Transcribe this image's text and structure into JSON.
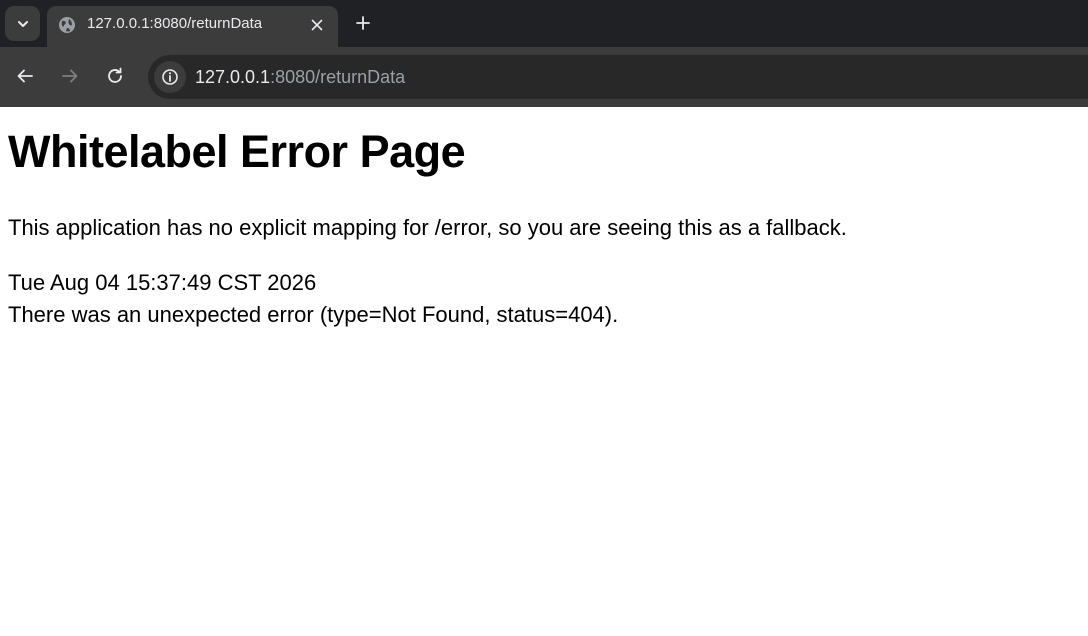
{
  "browser": {
    "tab": {
      "title": "127.0.0.1:8080/returnData"
    },
    "address_bar": {
      "host": "127.0.0.1",
      "path": ":8080/returnData"
    },
    "colors": {
      "tabstrip_bg": "#202124",
      "toolbar_bg": "#3c3c3c",
      "omnibox_bg": "#282828"
    }
  },
  "page": {
    "title": "Whitelabel Error Page",
    "message": "This application has no explicit mapping for /error, so you are seeing this as a fallback.",
    "timestamp": "Tue Aug 04 15:37:49 CST 2026",
    "error_detail": "There was an unexpected error (type=Not Found, status=404)."
  }
}
